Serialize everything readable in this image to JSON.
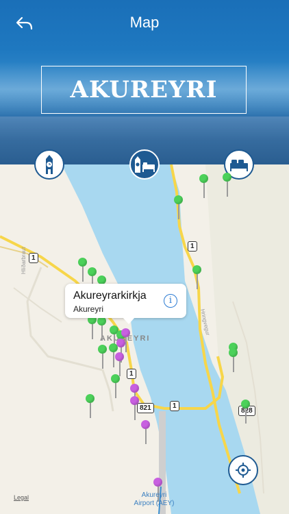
{
  "header": {
    "title": "Map",
    "city_name": "AKUREYRI"
  },
  "categories": [
    {
      "name": "Sights",
      "icon": "clock-tower-icon",
      "active": false
    },
    {
      "name": "All",
      "icon": "tower-and-bed-icon",
      "active": true
    },
    {
      "name": "Hotels",
      "icon": "bed-icon",
      "active": false
    }
  ],
  "callout": {
    "title": "Akureyrarkirkja",
    "subtitle": "Akureyri",
    "info_glyph": "i"
  },
  "map": {
    "town_label": "AKUREYRI",
    "airport_label_line1": "Akureyri",
    "airport_label_line2": "Airport (AEY)",
    "road_labels": [
      "1",
      "1",
      "1",
      "1",
      "821",
      "1",
      "828"
    ],
    "street_labels": [
      "Hlíðarbraut",
      "Hringvegur"
    ],
    "legal": "Legal"
  },
  "colors": {
    "accent": "#1e5a92",
    "water": "#a8d8f0",
    "road": "#f7d64a",
    "pin_green": "#4cd15a",
    "pin_purple": "#c860e0"
  }
}
